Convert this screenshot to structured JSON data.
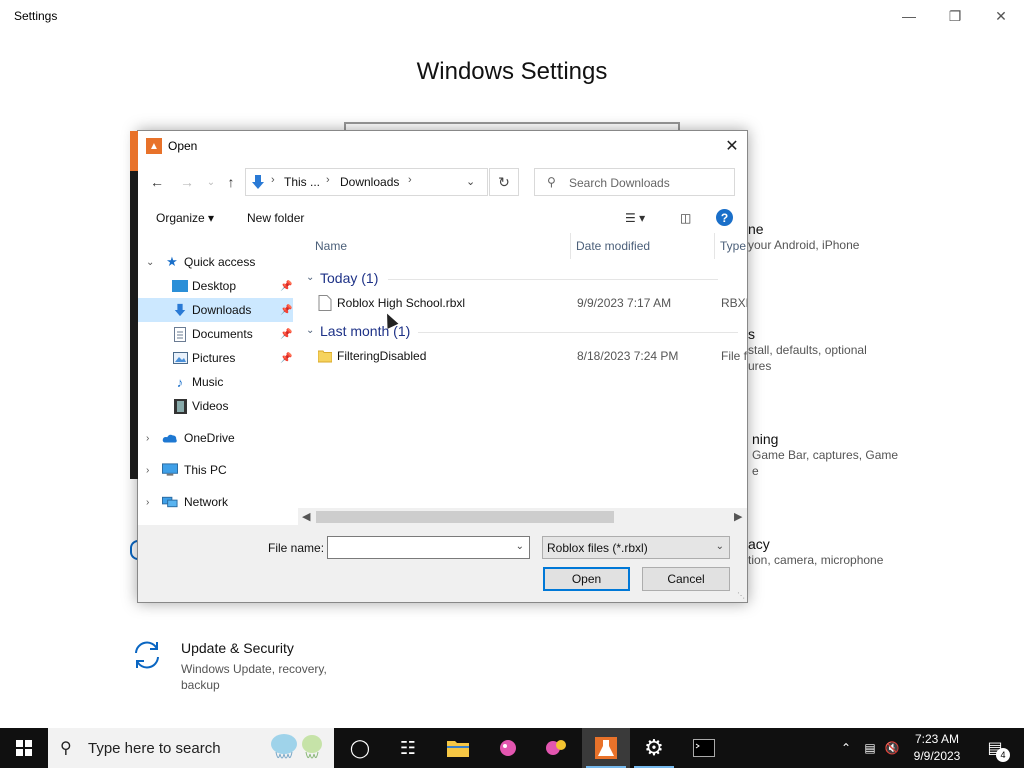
{
  "settings": {
    "window_title": "Settings",
    "heading": "Windows Settings",
    "categories": [
      {
        "title_fragment": "ne",
        "desc_fragment": "your Android, iPhone"
      },
      {
        "title_fragment": "s",
        "desc_fragment_1": "stall, defaults, optional",
        "desc_fragment_2": "ures"
      },
      {
        "title_fragment": "ning",
        "desc_fragment_1": "Game Bar, captures, Game",
        "desc_fragment_2": "e"
      },
      {
        "title_fragment": "acy",
        "desc_fragment": "tion, camera, microphone"
      }
    ],
    "update_security": {
      "title": "Update & Security",
      "desc": "Windows Update, recovery, backup"
    }
  },
  "dialog": {
    "title": "Open",
    "address": {
      "crumb1": "This ...",
      "crumb2": "Downloads"
    },
    "search_placeholder": "Search Downloads",
    "toolbar": {
      "organize": "Organize ▾",
      "new_folder": "New folder"
    },
    "nav": {
      "quick_access": "Quick access",
      "items": [
        {
          "label": "Desktop"
        },
        {
          "label": "Downloads"
        },
        {
          "label": "Documents"
        },
        {
          "label": "Pictures"
        },
        {
          "label": "Music"
        },
        {
          "label": "Videos"
        }
      ],
      "onedrive": "OneDrive",
      "this_pc": "This PC",
      "network": "Network"
    },
    "columns": {
      "name": "Name",
      "date": "Date modified",
      "type": "Type"
    },
    "groups": [
      {
        "label": "Today (1)",
        "files": [
          {
            "name": "Roblox High School.rbxl",
            "date": "9/9/2023 7:17 AM",
            "type": "RBXL"
          }
        ]
      },
      {
        "label": "Last month (1)",
        "files": [
          {
            "name": "FilteringDisabled",
            "date": "8/18/2023 7:24 PM",
            "type": "File f"
          }
        ]
      }
    ],
    "file_name_label": "File name:",
    "file_name_value": "",
    "filter_value": "Roblox files (*.rbxl)",
    "open_label": "Open",
    "cancel_label": "Cancel"
  },
  "taskbar": {
    "search_text": "Type here to search",
    "time": "7:23 AM",
    "date": "9/9/2023",
    "notification_count": "4"
  },
  "colors": {
    "accent": "#0078d7",
    "taskbar": "#101010",
    "app_orange": "#e8722a",
    "group_header": "#1e3287",
    "nav_selected": "#cce8ff"
  }
}
